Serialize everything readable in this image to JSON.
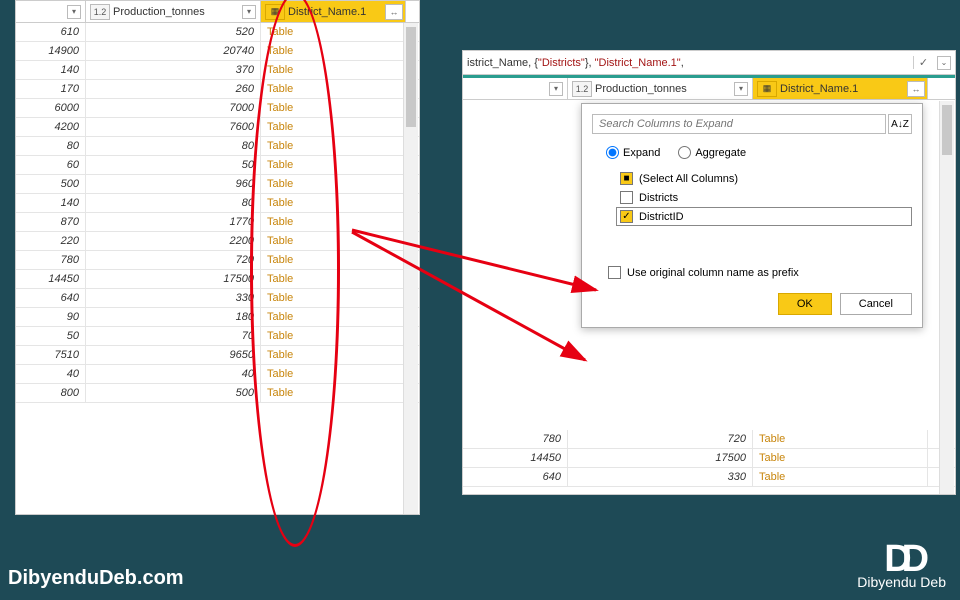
{
  "left_table": {
    "columns": {
      "prod": {
        "label": "Production_tonnes",
        "type_prefix": "1.2"
      },
      "dname": {
        "label": "District_Name.1"
      }
    },
    "filter_glyph": "▾",
    "expand_glyph": "↔",
    "col1_width": 70,
    "col2_width": 175,
    "col3_width": 145,
    "rows": [
      {
        "c1": "610",
        "c2": "520",
        "link": "Table"
      },
      {
        "c1": "14900",
        "c2": "20740",
        "link": "Table"
      },
      {
        "c1": "140",
        "c2": "370",
        "link": "Table"
      },
      {
        "c1": "170",
        "c2": "260",
        "link": "Table"
      },
      {
        "c1": "6000",
        "c2": "7000",
        "link": "Table"
      },
      {
        "c1": "4200",
        "c2": "7600",
        "link": "Table"
      },
      {
        "c1": "80",
        "c2": "80",
        "link": "Table"
      },
      {
        "c1": "60",
        "c2": "50",
        "link": "Table"
      },
      {
        "c1": "500",
        "c2": "960",
        "link": "Table"
      },
      {
        "c1": "140",
        "c2": "80",
        "link": "Table"
      },
      {
        "c1": "870",
        "c2": "1770",
        "link": "Table"
      },
      {
        "c1": "220",
        "c2": "2200",
        "link": "Table"
      },
      {
        "c1": "780",
        "c2": "720",
        "link": "Table"
      },
      {
        "c1": "14450",
        "c2": "17500",
        "link": "Table"
      },
      {
        "c1": "640",
        "c2": "330",
        "link": "Table"
      },
      {
        "c1": "90",
        "c2": "180",
        "link": "Table"
      },
      {
        "c1": "50",
        "c2": "70",
        "link": "Table"
      },
      {
        "c1": "7510",
        "c2": "9650",
        "link": "Table"
      },
      {
        "c1": "40",
        "c2": "40",
        "link": "Table"
      },
      {
        "c1": "800",
        "c2": "500",
        "link": "Table"
      }
    ]
  },
  "right_panel": {
    "formula_bar": {
      "prefix": "istrict_Name, {",
      "s1": "\"Districts\"",
      "mid1": "}, ",
      "s2": "\"District_Name.1\"",
      "suffix": ",",
      "done_glyph": "✓",
      "chev_glyph": "⌄"
    },
    "columns": {
      "prod": {
        "label": "Production_tonnes",
        "type_prefix": "1.2"
      },
      "dname": {
        "label": "District_Name.1"
      }
    },
    "visible_rows": [
      {
        "c1": "780",
        "c2": "720",
        "link": "Table"
      },
      {
        "c1": "14450",
        "c2": "17500",
        "link": "Table"
      },
      {
        "c1": "640",
        "c2": "330",
        "link": "Table"
      }
    ],
    "popup": {
      "search_placeholder": "Search Columns to Expand",
      "sort_glyph": "A↓Z",
      "radio": {
        "expand": "Expand",
        "aggregate": "Aggregate",
        "selected": "expand"
      },
      "select_all": "(Select All Columns)",
      "items": [
        {
          "label": "Districts",
          "checked": false,
          "focused": false
        },
        {
          "label": "DistrictID",
          "checked": true,
          "focused": true
        }
      ],
      "prefix_label": "Use original column name as prefix",
      "prefix_checked": false,
      "ok": "OK",
      "cancel": "Cancel"
    }
  },
  "watermark": {
    "left": "DibyenduDeb.com",
    "right_name": "Dibyendu Deb",
    "logo": "DD"
  }
}
